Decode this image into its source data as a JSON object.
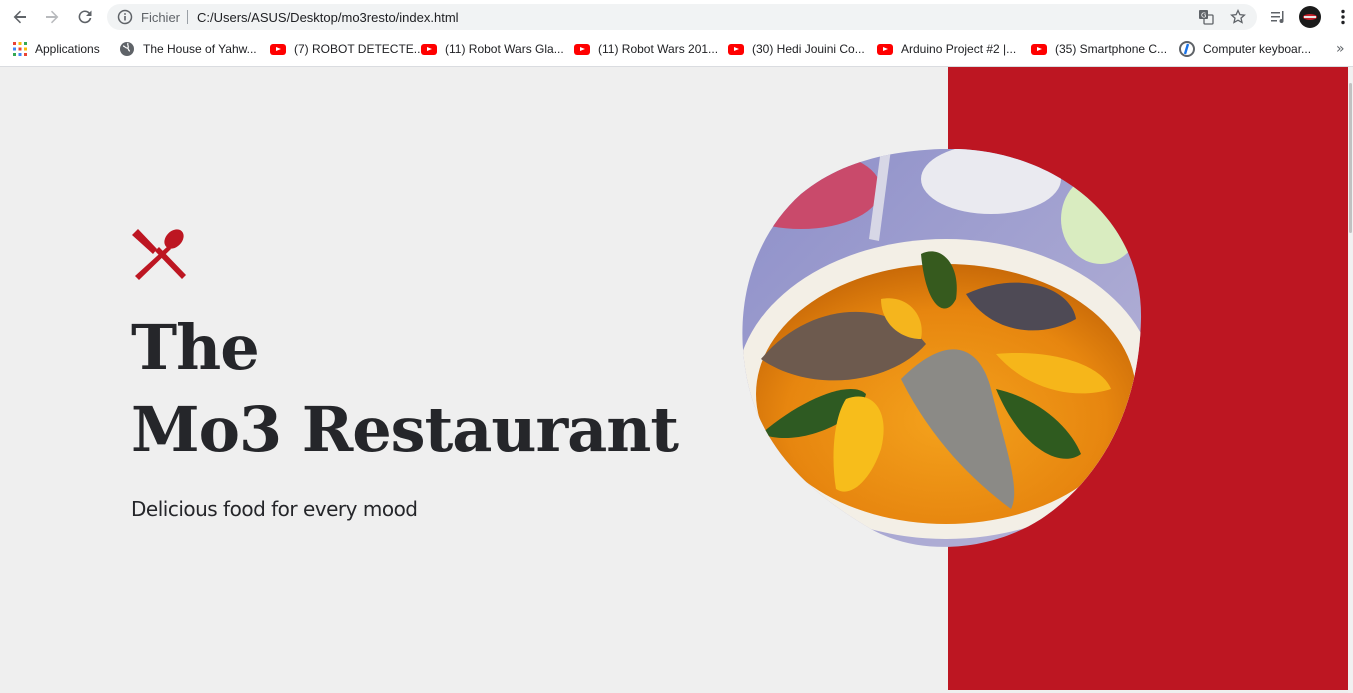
{
  "browser": {
    "scheme_label": "Fichier",
    "url": "C:/Users/ASUS/Desktop/mo3resto/index.html",
    "bookmarks": [
      {
        "label": "Applications",
        "icon": "apps-grid-icon"
      },
      {
        "label": "The House of Yahw...",
        "icon": "globe-icon"
      },
      {
        "label": "(7) ROBOT DETECTE...",
        "icon": "youtube-icon"
      },
      {
        "label": "(11) Robot Wars Gla...",
        "icon": "youtube-icon"
      },
      {
        "label": "(11) Robot Wars 201...",
        "icon": "youtube-icon"
      },
      {
        "label": "(30) Hedi Jouini Co...",
        "icon": "youtube-icon"
      },
      {
        "label": "Arduino Project #2 |...",
        "icon": "youtube-icon"
      },
      {
        "label": "(35) Smartphone C...",
        "icon": "youtube-icon"
      },
      {
        "label": "Computer keyboar...",
        "icon": "site-icon"
      }
    ],
    "overflow_label": "»"
  },
  "page": {
    "title_line1": "The",
    "title_line2": "Mo3 Restaurant",
    "tagline": "Delicious food for every mood",
    "logo_icon": "fork-spoon-icon",
    "hero_image": "couscous-fish-dish-image"
  },
  "colors": {
    "accent_red": "#bd1622",
    "background": "#efefef",
    "text_dark": "#25262a"
  }
}
